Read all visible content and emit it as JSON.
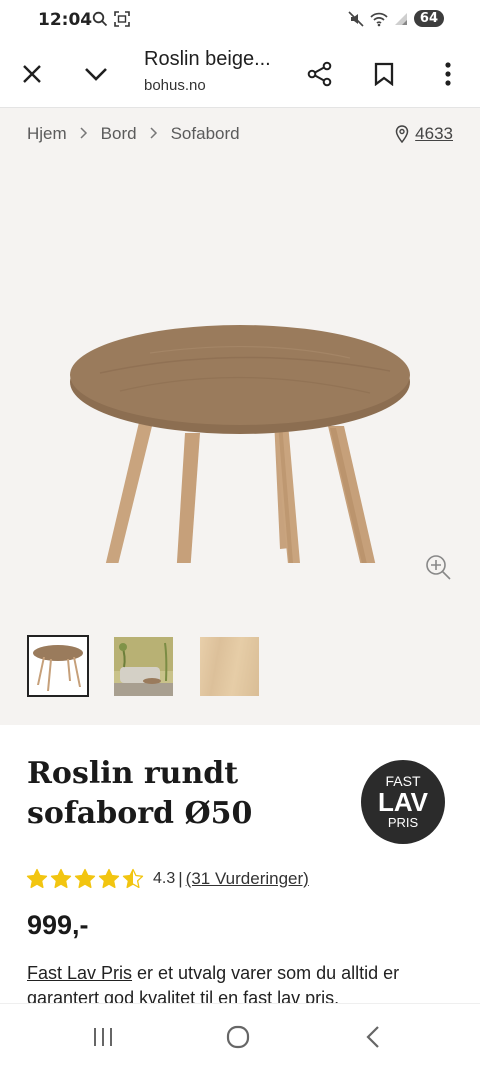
{
  "status_bar": {
    "time": "12:04",
    "battery": "64",
    "icons": [
      "search-icon",
      "screenshot-icon",
      "mute-icon",
      "wifi-icon",
      "signal-icon",
      "battery-icon"
    ]
  },
  "toolbar": {
    "title": "Roslin beige...",
    "domain": "bohus.no",
    "icons": [
      "close-icon",
      "chevron-down-icon",
      "share-icon",
      "bookmark-icon",
      "more-icon"
    ]
  },
  "breadcrumb": {
    "items": [
      "Hjem",
      "Bord",
      "Sofabord"
    ],
    "store_number": "4633"
  },
  "product": {
    "title": "Roslin rundt sofabord Ø50",
    "badge": {
      "top": "FAST",
      "mid": "LAV",
      "bottom": "PRIS"
    },
    "rating": {
      "value": "4.3",
      "separator": "|",
      "count_label": "(31 Vurderinger)",
      "stars": 4.5
    },
    "price": "999,-",
    "description_link": "Fast Lav Pris",
    "description_text": " er et utvalg varer som du alltid er garantert god kvalitet til en fast lav pris."
  },
  "colors": {
    "gallery_bg": "#f5f3f1",
    "star": "#f2c510",
    "badge_bg": "#2b2b2b",
    "wood": "#9a7b5c"
  }
}
